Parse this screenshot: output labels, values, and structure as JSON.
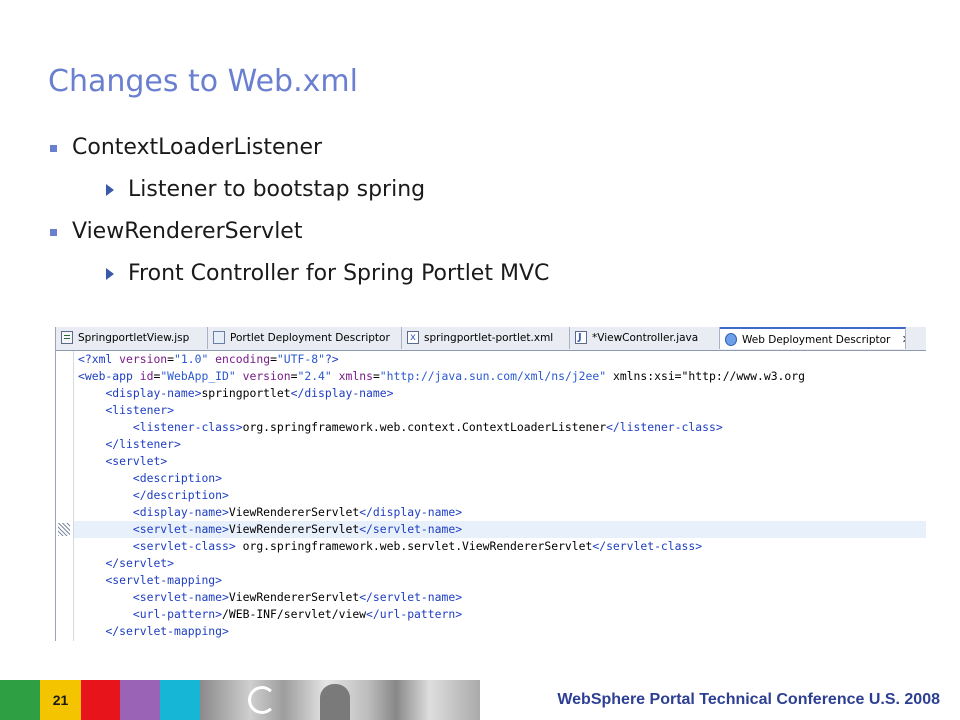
{
  "slide": {
    "title": "Changes to Web.xml",
    "bullets": [
      {
        "text": "ContextLoaderListener",
        "sub": "Listener to bootstap spring"
      },
      {
        "text": "ViewRendererServlet",
        "sub": "Front Controller for Spring Portlet MVC"
      }
    ]
  },
  "editor": {
    "tabs": [
      {
        "label": "SpringportletView.jsp",
        "icon": "jsp-file-icon"
      },
      {
        "label": "Portlet Deployment Descriptor",
        "icon": "descriptor-icon"
      },
      {
        "label": "springportlet-portlet.xml",
        "icon": "xml-file-icon"
      },
      {
        "label": "*ViewController.java",
        "icon": "java-file-icon"
      },
      {
        "label": "Web Deployment Descriptor",
        "icon": "globe-icon",
        "active": true
      }
    ],
    "close_glyph": "✕",
    "code_lines": [
      "<?xml version=\"1.0\" encoding=\"UTF-8\"?>",
      "<web-app id=\"WebApp_ID\" version=\"2.4\" xmlns=\"http://java.sun.com/xml/ns/j2ee\" xmlns:xsi=\"http://www.w3.org",
      "    <display-name>springportlet</display-name>",
      "    <listener>",
      "        <listener-class>org.springframework.web.context.ContextLoaderListener</listener-class>",
      "    </listener>",
      "    <servlet>",
      "        <description>",
      "        </description>",
      "        <display-name>ViewRendererServlet</display-name>",
      "        <servlet-name>ViewRendererServlet</servlet-name>",
      "        <servlet-class> org.springframework.web.servlet.ViewRendererServlet</servlet-class>",
      "    </servlet>",
      "    <servlet-mapping>",
      "        <servlet-name>ViewRendererServlet</servlet-name>",
      "        <url-pattern>/WEB-INF/servlet/view</url-pattern>",
      "    </servlet-mapping>"
    ],
    "highlighted_line": 10
  },
  "footer": {
    "page_number": "21",
    "conference": "WebSphere Portal Technical Conference U.S. 2008",
    "colors": [
      "#2ea043",
      "#f5c400",
      "#e8141c",
      "#9a63b6",
      "#16b7d6"
    ]
  }
}
